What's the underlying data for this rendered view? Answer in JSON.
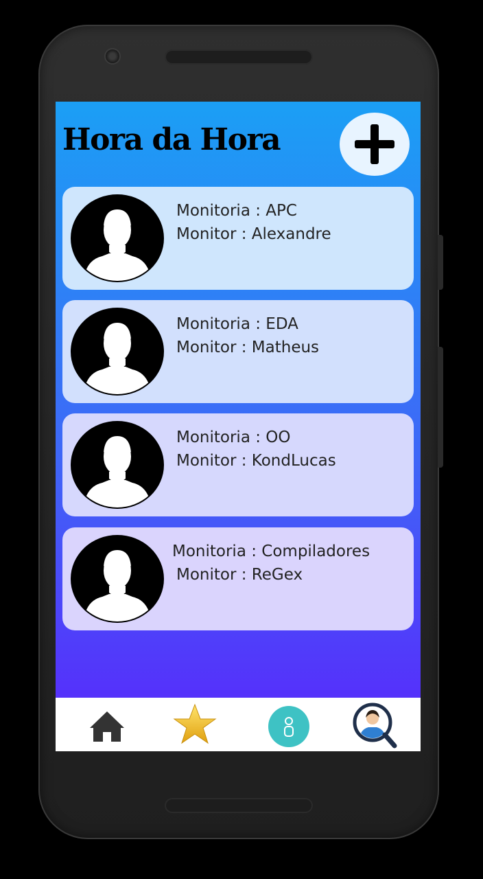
{
  "app": {
    "title": "Hora da Hora"
  },
  "actions": {
    "add_icon": "plus-icon"
  },
  "monitorias": [
    {
      "line1": "Monitoria : APC",
      "line2": "Monitor : Alexandre",
      "bg": "#cfe6fd"
    },
    {
      "line1": "Monitoria : EDA",
      "line2": "Monitor : Matheus",
      "bg": "#d2e0fd"
    },
    {
      "line1": "Monitoria : OO",
      "line2": "Monitor : KondLucas",
      "bg": "#d6d8fd"
    },
    {
      "line1": "Monitoria : Compiladores",
      "line2": "Monitor : ReGex",
      "bg": "#dad4fd"
    }
  ],
  "bottom_nav": {
    "items": [
      {
        "icon": "home-icon"
      },
      {
        "icon": "star-icon"
      },
      {
        "icon": "teal-circle-icon"
      },
      {
        "icon": "user-search-icon"
      }
    ]
  },
  "colors": {
    "gradient_top": "#1b9ff5",
    "gradient_bottom": "#5531fb",
    "star": "#f5c518",
    "teal": "#3ec2c4"
  }
}
